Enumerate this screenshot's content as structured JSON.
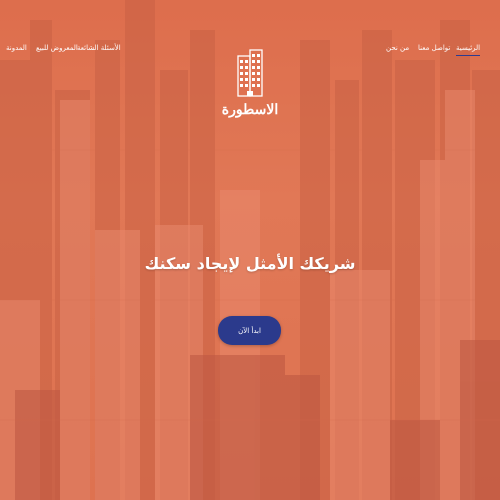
{
  "nav": {
    "items": [
      {
        "label": "الرئيسية",
        "active": true
      },
      {
        "label": "تواصل معنا",
        "active": false
      },
      {
        "label": "من نحن",
        "active": false
      },
      {
        "label": "الأسئلة الشائعة",
        "active": false
      },
      {
        "label": "المعروض للبيع",
        "active": false
      },
      {
        "label": "المدونة",
        "active": false
      }
    ]
  },
  "logo": {
    "text": "الاسطورة",
    "icon": "building-icon"
  },
  "hero": {
    "tagline": "شريكك الأمثل لإيجاد سكنك",
    "cta_label": "ابدأ الآن"
  },
  "colors": {
    "accent": "#2b3a8c",
    "overlay": "#e07452",
    "text": "#ffffff"
  }
}
